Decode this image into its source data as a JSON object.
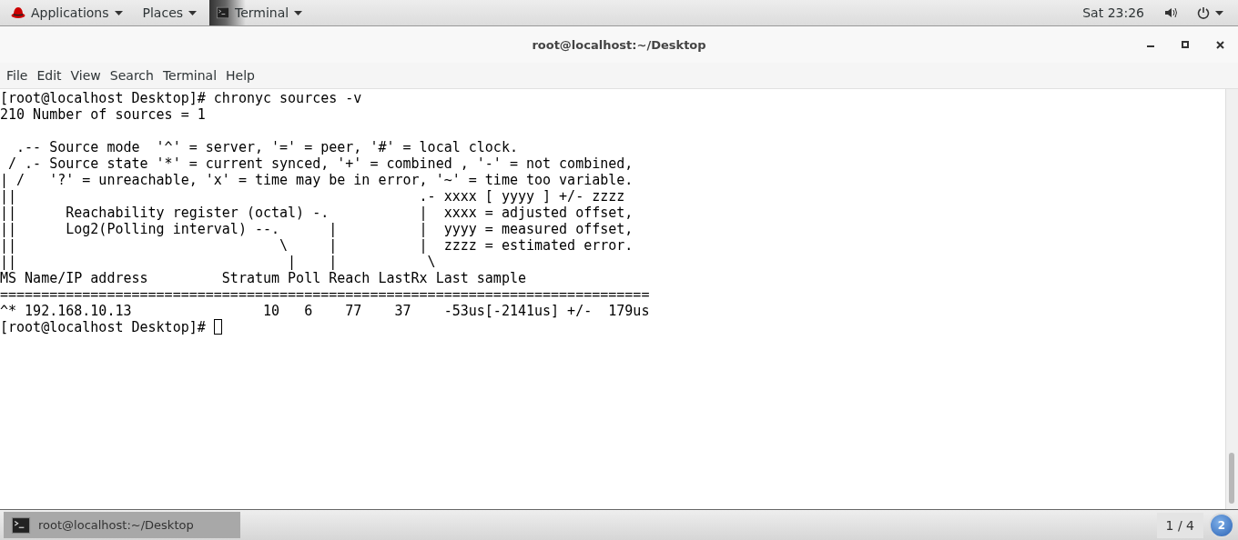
{
  "top_bar": {
    "menus": [
      {
        "label": "Applications",
        "kind": "logo"
      },
      {
        "label": "Places",
        "kind": "plain"
      },
      {
        "label": "Terminal",
        "kind": "app"
      }
    ],
    "clock": "Sat 23:26"
  },
  "window": {
    "title": "root@localhost:~/Desktop"
  },
  "menu_bar": [
    "File",
    "Edit",
    "View",
    "Search",
    "Terminal",
    "Help"
  ],
  "terminal": {
    "blocks": [
      [
        "[root@localhost Desktop]# chronyc sources -v",
        "210 Number of sources = 1"
      ],
      [
        "  .-- Source mode  '^' = server, '=' = peer, '#' = local clock.",
        " / .- Source state '*' = current synced, '+' = combined , '-' = not combined,",
        "| /   '?' = unreachable, 'x' = time may be in error, '~' = time too variable.",
        "||                                                 .- xxxx [ yyyy ] +/- zzzz",
        "||      Reachability register (octal) -.           |  xxxx = adjusted offset,",
        "||      Log2(Polling interval) --.      |          |  yyyy = measured offset,",
        "||                                \\     |          |  zzzz = estimated error.",
        "||                                 |    |           \\",
        "MS Name/IP address         Stratum Poll Reach LastRx Last sample",
        "===============================================================================",
        "^* 192.168.10.13                10   6    77    37    -53us[-2141us] +/-  179us"
      ]
    ],
    "prompt": "[root@localhost Desktop]#"
  },
  "taskbar": {
    "window_button": {
      "label": "root@localhost:~/Desktop",
      "selected": true
    },
    "workspace": "1 / 4",
    "notifications": "2"
  }
}
